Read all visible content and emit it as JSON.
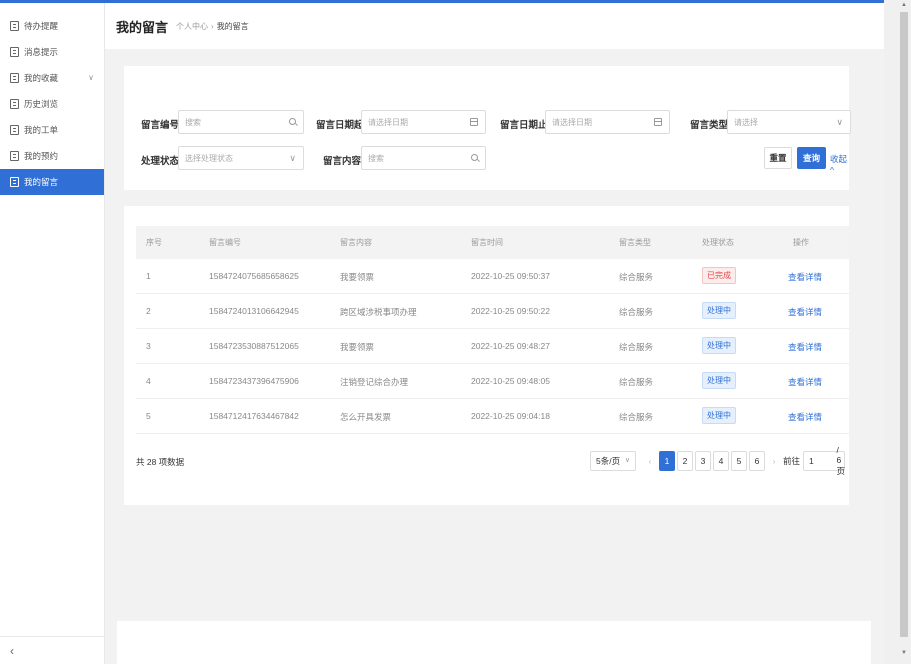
{
  "sidebar": {
    "items": [
      {
        "label": "待办提醒"
      },
      {
        "label": "消息提示"
      },
      {
        "label": "我的收藏"
      },
      {
        "label": "历史浏览"
      },
      {
        "label": "我的工单"
      },
      {
        "label": "我的预约"
      },
      {
        "label": "我的留言"
      }
    ],
    "active_index": 6,
    "expand_glyph": "∨",
    "collapse_glyph": "‹"
  },
  "header": {
    "title": "我的留言",
    "breadcrumb": [
      "个人中心",
      "我的留言"
    ],
    "breadcrumb_sep": "›"
  },
  "filters": {
    "msg_no": {
      "label": "留言编号",
      "placeholder": "搜索"
    },
    "date_start": {
      "label": "留言日期起",
      "placeholder": "请选择日期"
    },
    "date_end": {
      "label": "留言日期止",
      "placeholder": "请选择日期"
    },
    "msg_type": {
      "label": "留言类型",
      "placeholder": "请选择"
    },
    "status": {
      "label": "处理状态",
      "placeholder": "选择处理状态"
    },
    "content": {
      "label": "留言内容",
      "placeholder": "搜索"
    },
    "reset_label": "重置",
    "query_label": "查询",
    "collapse_label": "收起^"
  },
  "table": {
    "columns": [
      "序号",
      "留言编号",
      "留言内容",
      "留言时间",
      "留言类型",
      "处理状态",
      "操作"
    ],
    "rows": [
      {
        "idx": "1",
        "no": "1584724075685658625",
        "content": "我要领票",
        "time": "2022-10-25 09:50:37",
        "type": "综合服务",
        "status": "已完成",
        "status_kind": "done",
        "action": "查看详情"
      },
      {
        "idx": "2",
        "no": "1584724013106642945",
        "content": "跨区域涉税事项办理",
        "time": "2022-10-25 09:50:22",
        "type": "综合服务",
        "status": "处理中",
        "status_kind": "proc",
        "action": "查看详情"
      },
      {
        "idx": "3",
        "no": "1584723530887512065",
        "content": "我要领票",
        "time": "2022-10-25 09:48:27",
        "type": "综合服务",
        "status": "处理中",
        "status_kind": "proc",
        "action": "查看详情"
      },
      {
        "idx": "4",
        "no": "1584723437396475906",
        "content": "注销登记综合办理",
        "time": "2022-10-25 09:48:05",
        "type": "综合服务",
        "status": "处理中",
        "status_kind": "proc",
        "action": "查看详情"
      },
      {
        "idx": "5",
        "no": "1584712417634467842",
        "content": "怎么开具发票",
        "time": "2022-10-25 09:04:18",
        "type": "综合服务",
        "status": "处理中",
        "status_kind": "proc",
        "action": "查看详情"
      }
    ]
  },
  "pagination": {
    "total_text": "共 28 项数据",
    "page_size": "5条/页",
    "prev": "‹",
    "next": "›",
    "pages": [
      "1",
      "2",
      "3",
      "4",
      "5",
      "6"
    ],
    "current_page": "1",
    "jump_label": "前往",
    "jump_value": "1",
    "total_pages_text": "/ 6 页"
  },
  "colors": {
    "accent": "#2f6fd6",
    "done_text": "#e04b4b",
    "background": "#f2f2f2"
  }
}
